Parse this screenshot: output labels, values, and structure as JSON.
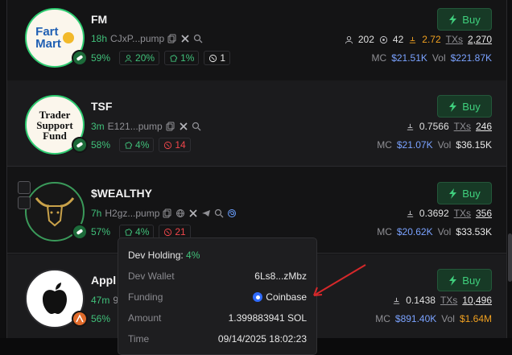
{
  "rows": [
    {
      "ticker": "FM",
      "avatar_text": [
        "Fart",
        "Mart"
      ],
      "age": "18h",
      "address": "CJxP...pump",
      "stats": [
        "59%",
        "20%",
        "1%",
        "1"
      ],
      "holders": "202",
      "pro": "42",
      "rank": "2.72",
      "txs_label": "TXs",
      "txs": "2,270",
      "mc_label": "MC",
      "mc": "$21.51K",
      "vol_label": "Vol",
      "vol": "$221.87K",
      "buy_label": "Buy"
    },
    {
      "ticker": "TSF",
      "avatar_text": [
        "Trader",
        "Support",
        "Fund"
      ],
      "age": "3m",
      "address": "E121...pump",
      "stats": [
        "58%",
        "4%",
        "14"
      ],
      "fee": "0.7566",
      "txs_label": "TXs",
      "txs": "246",
      "mc_label": "MC",
      "mc": "$21.07K",
      "vol_label": "Vol",
      "vol": "$36.15K",
      "buy_label": "Buy"
    },
    {
      "ticker": "$WEALTHY",
      "age": "7h",
      "address": "H2gz...pump",
      "stats": [
        "57%",
        "4%",
        "21"
      ],
      "fee": "0.3692",
      "txs_label": "TXs",
      "txs": "356",
      "mc_label": "MC",
      "mc": "$20.62K",
      "vol_label": "Vol",
      "vol": "$33.53K",
      "buy_label": "Buy"
    },
    {
      "ticker": "Appl",
      "age": "47m",
      "address": "9",
      "stats": [
        "56%"
      ],
      "fee": "0.1438",
      "txs_label": "TXs",
      "txs": "10,496",
      "mc_label": "MC",
      "mc": "$891.40K",
      "vol_label": "Vol",
      "vol": "$1.64M",
      "buy_label": "Buy"
    }
  ],
  "tooltip": {
    "dev_holding_label": "Dev Holding:",
    "dev_holding_value": "4%",
    "dev_wallet_label": "Dev Wallet",
    "dev_wallet_value": "6Ls8...zMbz",
    "funding_label": "Funding",
    "funding_value": "Coinbase",
    "amount_label": "Amount",
    "amount_value": "1.399883941 SOL",
    "time_label": "Time",
    "time_value": "09/14/2025 18:02:23"
  },
  "colors": {
    "green": "#40c07a",
    "red": "#f0464b",
    "blue": "#7aa2ff",
    "orange": "#f0a020",
    "arrow": "#d6282a"
  }
}
